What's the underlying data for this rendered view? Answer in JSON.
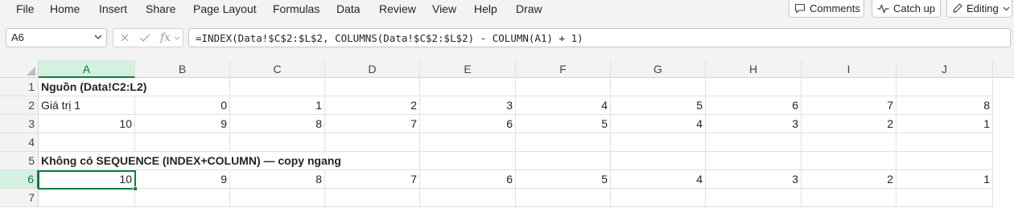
{
  "menu": [
    "File",
    "Home",
    "Insert",
    "Share",
    "Page Layout",
    "Formulas",
    "Data",
    "Review",
    "View",
    "Help",
    "Draw"
  ],
  "ribbon_buttons": {
    "comments": "Comments",
    "catch_up": "Catch up",
    "editing": "Editing"
  },
  "name_box": "A6",
  "fx_label": "fx",
  "formula": "=INDEX(Data!$C$2:$L$2, COLUMNS(Data!$C$2:$L$2) - COLUMN(A1) + 1)",
  "columns": [
    "A",
    "B",
    "C",
    "D",
    "E",
    "F",
    "G",
    "H",
    "I",
    "J"
  ],
  "rows": [
    "1",
    "2",
    "3",
    "4",
    "5",
    "6",
    "7"
  ],
  "active_cell": "A6",
  "cells": {
    "r1": {
      "A": "Nguồn (Data!C2:L2)"
    },
    "r2": {
      "A": "Giá trị 1",
      "B": "0",
      "C": "1",
      "D": "2",
      "E": "3",
      "F": "4",
      "G": "5",
      "H": "6",
      "I": "7",
      "J": "8"
    },
    "r3": {
      "A": "10",
      "B": "9",
      "C": "8",
      "D": "7",
      "E": "6",
      "F": "5",
      "G": "4",
      "H": "3",
      "I": "2",
      "J": "1"
    },
    "r5": {
      "A": "Không có SEQUENCE (INDEX+COLUMN) — copy ngang"
    },
    "r6": {
      "A": "10",
      "B": "9",
      "C": "8",
      "D": "7",
      "E": "6",
      "F": "5",
      "G": "4",
      "H": "3",
      "I": "2",
      "J": "1"
    }
  },
  "colors": {
    "accent": "#107c41",
    "header_bg": "#f3f3f3",
    "active_header_bg": "#d3f0e0"
  }
}
